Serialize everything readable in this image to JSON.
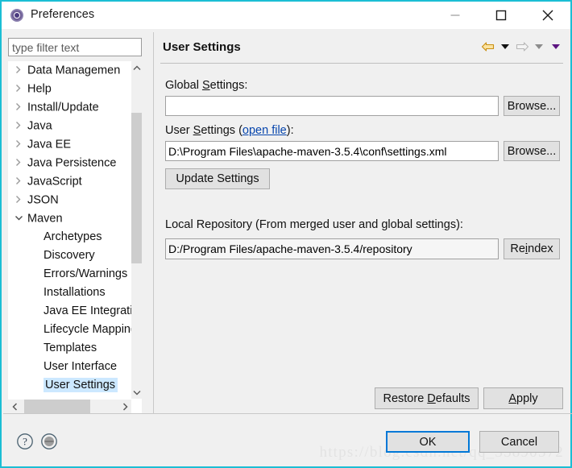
{
  "window": {
    "title": "Preferences",
    "icon": "preferences-gear-icon",
    "border_color": "#1bbed4",
    "controls": {
      "minimize": "minimize-icon",
      "maximize": "maximize-icon",
      "close": "close-icon"
    }
  },
  "filter": {
    "placeholder": "type filter text",
    "value": ""
  },
  "tree": {
    "items": [
      {
        "label": "Data Managemen",
        "level": 0,
        "expandable": true,
        "expanded": false,
        "selected": false
      },
      {
        "label": "Help",
        "level": 0,
        "expandable": true,
        "expanded": false,
        "selected": false
      },
      {
        "label": "Install/Update",
        "level": 0,
        "expandable": true,
        "expanded": false,
        "selected": false
      },
      {
        "label": "Java",
        "level": 0,
        "expandable": true,
        "expanded": false,
        "selected": false
      },
      {
        "label": "Java EE",
        "level": 0,
        "expandable": true,
        "expanded": false,
        "selected": false
      },
      {
        "label": "Java Persistence",
        "level": 0,
        "expandable": true,
        "expanded": false,
        "selected": false
      },
      {
        "label": "JavaScript",
        "level": 0,
        "expandable": true,
        "expanded": false,
        "selected": false
      },
      {
        "label": "JSON",
        "level": 0,
        "expandable": true,
        "expanded": false,
        "selected": false
      },
      {
        "label": "Maven",
        "level": 0,
        "expandable": true,
        "expanded": true,
        "selected": false
      },
      {
        "label": "Archetypes",
        "level": 1,
        "expandable": false,
        "expanded": false,
        "selected": false
      },
      {
        "label": "Discovery",
        "level": 1,
        "expandable": false,
        "expanded": false,
        "selected": false
      },
      {
        "label": "Errors/Warnings",
        "level": 1,
        "expandable": false,
        "expanded": false,
        "selected": false
      },
      {
        "label": "Installations",
        "level": 1,
        "expandable": false,
        "expanded": false,
        "selected": false
      },
      {
        "label": "Java EE Integration",
        "level": 1,
        "expandable": false,
        "expanded": false,
        "selected": false
      },
      {
        "label": "Lifecycle Mappings",
        "level": 1,
        "expandable": false,
        "expanded": false,
        "selected": false
      },
      {
        "label": "Templates",
        "level": 1,
        "expandable": false,
        "expanded": false,
        "selected": false
      },
      {
        "label": "User Interface",
        "level": 1,
        "expandable": false,
        "expanded": false,
        "selected": false
      },
      {
        "label": "User Settings",
        "level": 1,
        "expandable": false,
        "expanded": false,
        "selected": true
      }
    ],
    "selection_color": "#cce8ff"
  },
  "panel": {
    "title": "User Settings",
    "nav": {
      "back": "back-arrow-icon",
      "back_menu": "back-dropdown-icon",
      "forward": "forward-arrow-icon",
      "forward_menu": "forward-dropdown-icon",
      "more": "more-dropdown-icon",
      "back_color": "#e8b53a",
      "forward_color": "#b8b8b8",
      "more_color": "#6a0f8e"
    },
    "global_settings": {
      "label_prefix": "Global ",
      "label_mnemonic": "S",
      "label_suffix": "ettings:",
      "value": "",
      "browse_label": "Browse..."
    },
    "user_settings": {
      "label_prefix": "User ",
      "label_mnemonic": "S",
      "label_mid": "ettings (",
      "link_label": "open file",
      "label_suffix": "):",
      "value": "D:\\Program Files\\apache-maven-3.5.4\\conf\\settings.xml",
      "browse_label": "Browse..."
    },
    "update_settings_label": "Update Settings",
    "local_repository": {
      "label": "Local Repository (From merged user and global settings):",
      "value": "D:/Program Files/apache-maven-3.5.4/repository",
      "reindex_prefix": "Re",
      "reindex_mnemonic": "i",
      "reindex_suffix": "ndex"
    },
    "restore_defaults": {
      "prefix": "Restore ",
      "mnemonic": "D",
      "suffix": "efaults"
    },
    "apply": {
      "prefix": "",
      "mnemonic": "A",
      "suffix": "pply"
    }
  },
  "footer": {
    "help_icon": "help-question-icon",
    "shell_icon": "command-shell-icon",
    "ok_label": "OK",
    "cancel_label": "Cancel",
    "ok_focus_color": "#0078d7",
    "watermark": "https://blog.csdn.net/qq_35890572"
  }
}
